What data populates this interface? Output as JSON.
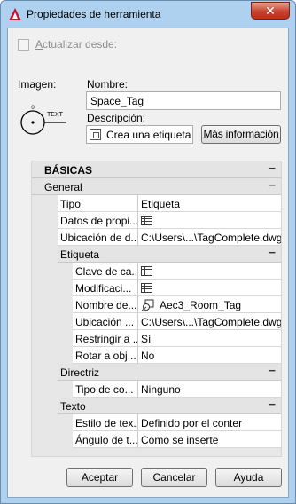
{
  "window": {
    "title": "Propiedades de herramienta",
    "close_glyph": "✕"
  },
  "update_from": {
    "label_prefix": "",
    "label_underlined": "A",
    "label_rest": "ctualizar desde:",
    "checked": false,
    "enabled": false
  },
  "image": {
    "label": "Imagen:",
    "preview_text": "TEXT",
    "preview_number": "0"
  },
  "name": {
    "label": "Nombre:",
    "value": "Space_Tag"
  },
  "description": {
    "label": "Descripción:",
    "value": "Crea una etiqueta d",
    "more_info_label": "Más información"
  },
  "grid": {
    "top_category": "BÁSICAS",
    "general": {
      "label": "General",
      "rows": [
        {
          "name": "Tipo",
          "value": "Etiqueta"
        },
        {
          "name": "Datos de propi...",
          "value": "",
          "icon": "table-icon"
        },
        {
          "name": "Ubicación de d...",
          "value": "C:\\Users\\...\\TagComplete.dwg"
        }
      ]
    },
    "etiqueta": {
      "label": "Etiqueta",
      "rows": [
        {
          "name": "Clave de ca...",
          "value": "",
          "icon": "table-icon"
        },
        {
          "name": "Modificaci...",
          "value": "",
          "icon": "table-icon"
        },
        {
          "name": "Nombre de...",
          "value": "Aec3_Room_Tag",
          "icon": "tag-block-icon"
        },
        {
          "name": "Ubicación ...",
          "value": "C:\\Users\\...\\TagComplete.dwg"
        },
        {
          "name": "Restringir a ...",
          "value": "Sí"
        },
        {
          "name": "Rotar a obj...",
          "value": "No"
        }
      ]
    },
    "directriz": {
      "label": "Directriz",
      "rows": [
        {
          "name": "Tipo de co...",
          "value": "Ninguno"
        }
      ]
    },
    "texto": {
      "label": "Texto",
      "rows": [
        {
          "name": "Estilo de tex...",
          "value": "Definido por el conter"
        },
        {
          "name": "Ángulo de t...",
          "value": "Como se inserte"
        }
      ]
    },
    "collapse_glyph": "−"
  },
  "buttons": {
    "ok": "Aceptar",
    "cancel": "Cancelar",
    "help": "Ayuda"
  },
  "colors": {
    "titlebar": "#aed1ef",
    "close_button": "#c7432f",
    "client_bg": "#f0f0f0"
  }
}
